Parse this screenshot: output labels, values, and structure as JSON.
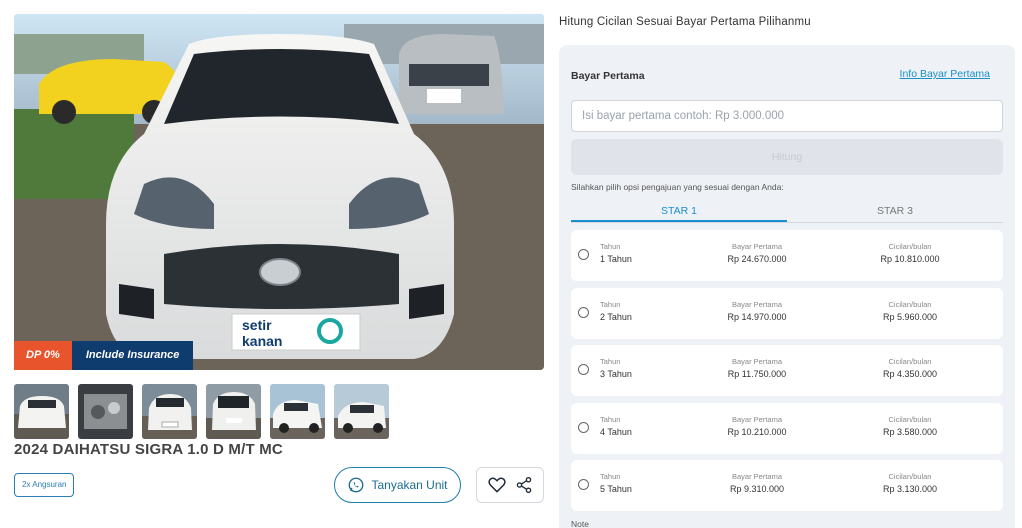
{
  "listing": {
    "title": "2024 DAIHATSU SIGRA 1.0 D M/T MC",
    "badges": {
      "dp": "DP 0%",
      "insurance": "Include Insurance"
    },
    "dealer_logo": {
      "line1": "setir",
      "line2": "kanan"
    },
    "installment_tag": "2x Angsuran",
    "ask_button": "Tanyakan Unit",
    "thumbnail_count": 6
  },
  "calculator": {
    "heading": "Hitung Cicilan Sesuai Bayar Pertama Pilihanmu",
    "label": "Bayar Pertama",
    "info_link": "Info Bayar Pertama",
    "input_placeholder": "Isi bayar pertama contoh: Rp 3.000.000",
    "input_value": "",
    "button": "Hitung",
    "hint": "Silahkan pilih opsi pengajuan yang sesuai dengan Anda:",
    "tabs": [
      {
        "label": "STAR 1",
        "active": true
      },
      {
        "label": "STAR 3",
        "active": false
      }
    ],
    "col_labels": {
      "tenor": "Tahun",
      "dp": "Bayar Pertama",
      "installment": "Cicilan/bulan"
    },
    "options": [
      {
        "tenor": "1 Tahun",
        "dp": "Rp 24.670.000",
        "installment": "Rp 10.810.000"
      },
      {
        "tenor": "2 Tahun",
        "dp": "Rp 14.970.000",
        "installment": "Rp 5.960.000"
      },
      {
        "tenor": "3 Tahun",
        "dp": "Rp 11.750.000",
        "installment": "Rp 4.350.000"
      },
      {
        "tenor": "4 Tahun",
        "dp": "Rp 10.210.000",
        "installment": "Rp 3.580.000"
      },
      {
        "tenor": "5 Tahun",
        "dp": "Rp 9.310.000",
        "installment": "Rp 3.130.000"
      }
    ],
    "note": "Note"
  },
  "colors": {
    "accent": "#1a8fd0",
    "dp_badge": "#e8542c",
    "insurance_badge": "#0f3c6e",
    "panel_bg": "#eef1f6"
  },
  "icons": {
    "chat": "whatsapp-icon",
    "favorite": "heart-icon",
    "share": "share-icon"
  }
}
